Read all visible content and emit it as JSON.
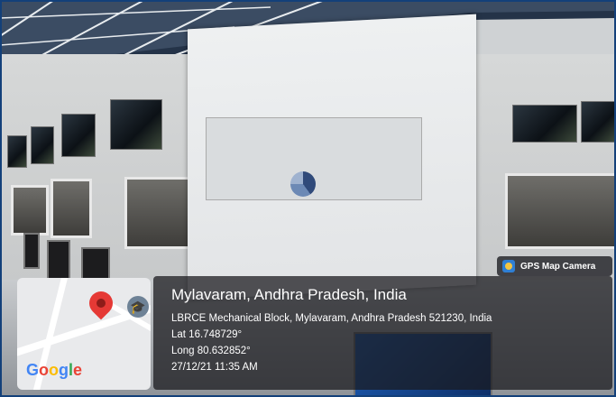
{
  "badge": {
    "label": "GPS Map Camera",
    "icon": "camera-icon"
  },
  "location": {
    "title": "Mylavaram, Andhra Pradesh, India",
    "address": "LBRCE Mechanical Block, Mylavaram, Andhra Pradesh 521230, India",
    "lat": "Lat 16.748729°",
    "long": "Long 80.632852°",
    "datetime": "27/12/21 11:35 AM"
  },
  "map": {
    "logo": "Google",
    "pin_icon": "map-pin-icon",
    "place_icon": "graduation-cap-icon",
    "colors": {
      "pin": "#e53935",
      "google_blue": "#4285f4",
      "google_red": "#ea4335",
      "google_yellow": "#fbbc05",
      "google_green": "#34a853"
    }
  }
}
